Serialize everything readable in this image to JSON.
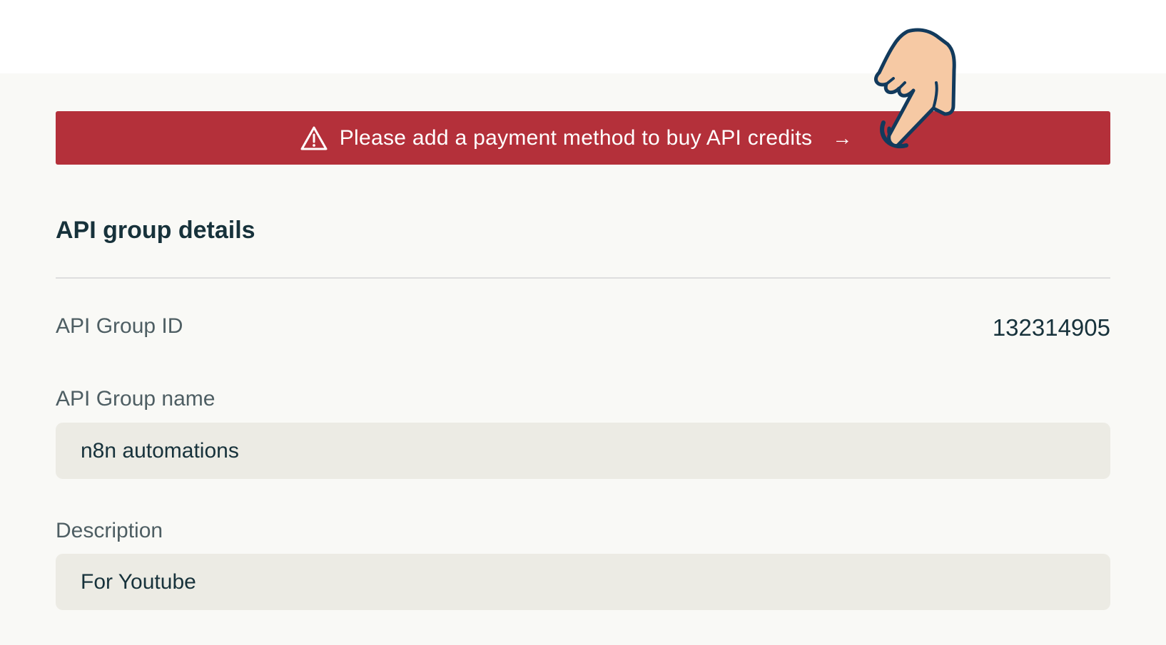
{
  "alert": {
    "icon": "warning-triangle-icon",
    "text": "Please add a payment method to buy API credits",
    "arrow": "→",
    "color": "#b4303a"
  },
  "section": {
    "title": "API group details"
  },
  "group_id": {
    "label": "API Group ID",
    "value": "132314905"
  },
  "group_name": {
    "label": "API Group name",
    "value": "n8n automations"
  },
  "description": {
    "label": "Description",
    "value": "For Youtube"
  },
  "pointer": {
    "icon": "pointing-hand-cursor-icon"
  }
}
